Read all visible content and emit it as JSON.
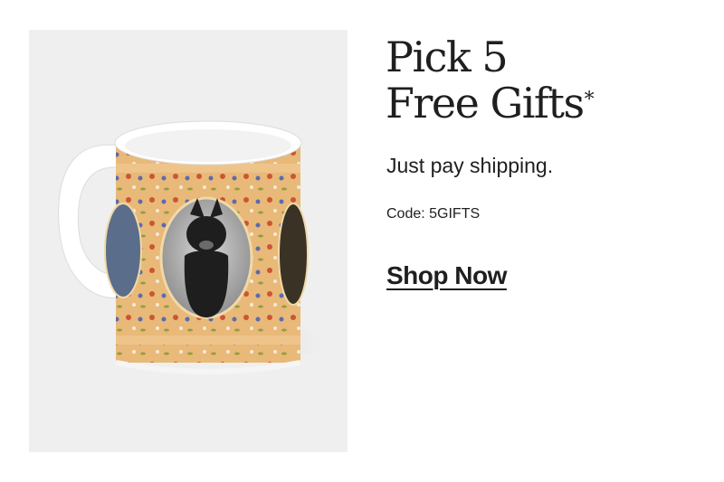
{
  "promo": {
    "headline_line1": "Pick 5",
    "headline_line2": "Free Gifts",
    "asterisk": "*",
    "subhead": "Just pay shipping.",
    "code": "Code: 5GIFTS",
    "cta": "Shop Now"
  },
  "product_image": {
    "subject": "photo mug with dog portraits and floral pattern",
    "colors": {
      "panel": "#efefef",
      "mug_body": "#e8b978",
      "flower_red": "#c94a2b",
      "flower_blue": "#4b62b5",
      "leaf": "#8a9a3a"
    }
  }
}
